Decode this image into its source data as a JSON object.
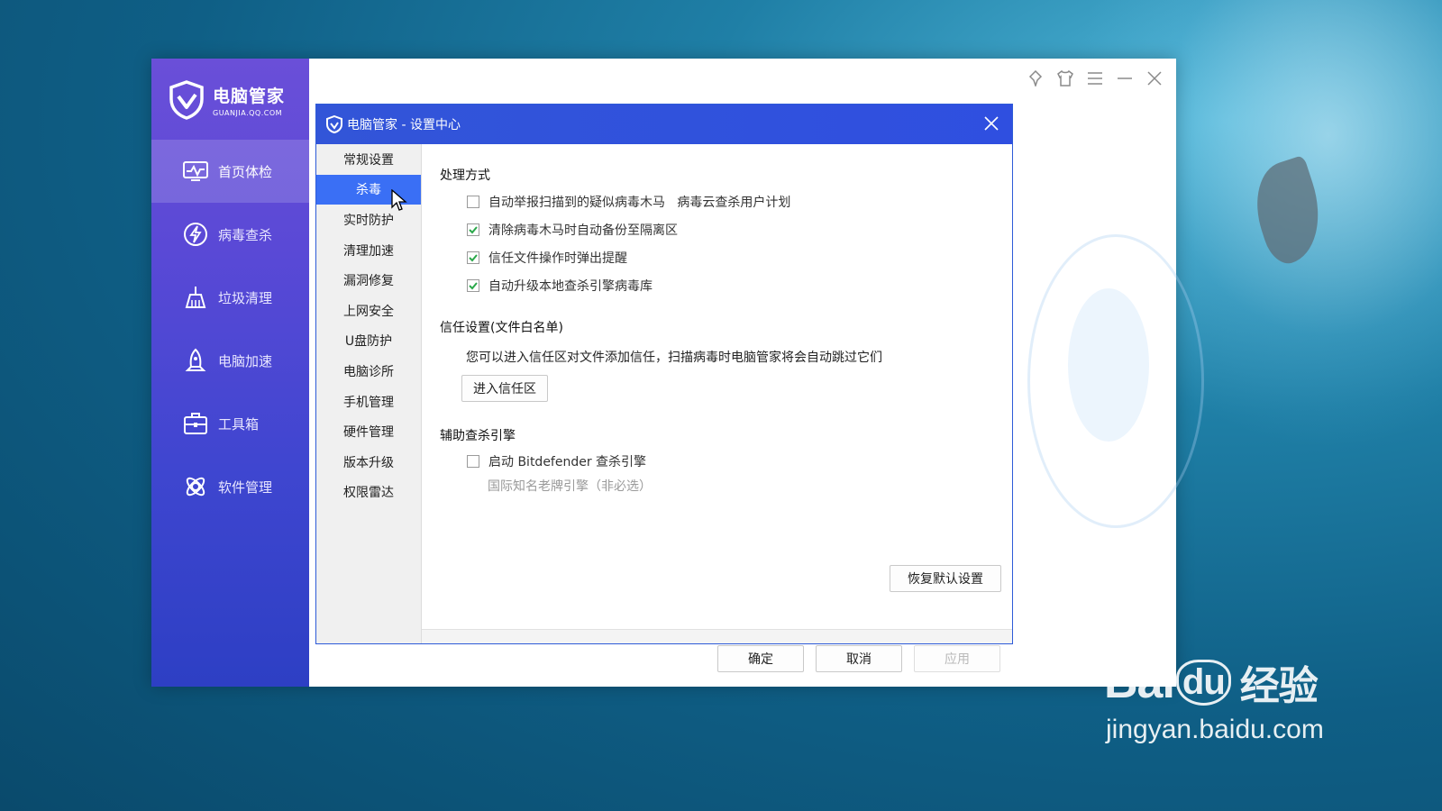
{
  "app": {
    "logo_title": "电脑管家",
    "logo_subtitle": "GUANJIA.QQ.COM",
    "nav": [
      {
        "label": "首页体检",
        "icon": "monitor-pulse-icon",
        "active": true
      },
      {
        "label": "病毒查杀",
        "icon": "lightning-shield-icon"
      },
      {
        "label": "垃圾清理",
        "icon": "broom-icon"
      },
      {
        "label": "电脑加速",
        "icon": "rocket-icon"
      },
      {
        "label": "工具箱",
        "icon": "toolbox-icon"
      },
      {
        "label": "软件管理",
        "icon": "apps-icon"
      }
    ],
    "window_controls": [
      "pin-icon",
      "shirt-skin-icon",
      "menu-icon",
      "minimize-icon",
      "close-icon"
    ]
  },
  "dialog": {
    "title": "电脑管家 - 设置中心",
    "left_nav": [
      "常规设置",
      "杀毒",
      "实时防护",
      "清理加速",
      "漏洞修复",
      "上网安全",
      "U盘防护",
      "电脑诊所",
      "手机管理",
      "硬件管理",
      "版本升级",
      "权限雷达"
    ],
    "active_index": 1,
    "section1_title": "处理方式",
    "options": [
      {
        "label": "自动举报扫描到的疑似病毒木马   病毒云查杀用户计划",
        "checked": false
      },
      {
        "label": "清除病毒木马时自动备份至隔离区",
        "checked": true
      },
      {
        "label": "信任文件操作时弹出提醒",
        "checked": true
      },
      {
        "label": "自动升级本地查杀引擎病毒库",
        "checked": true
      }
    ],
    "section2_title": "信任设置(文件白名单)",
    "trust_desc": "您可以进入信任区对文件添加信任，扫描病毒时电脑管家将会自动跳过它们",
    "trust_button": "进入信任区",
    "section3_title": "辅助查杀引擎",
    "engine_option": {
      "label": "启动 Bitdefender 查杀引擎",
      "checked": false
    },
    "engine_note": "国际知名老牌引擎（非必选）",
    "restore_button": "恢复默认设置",
    "ok_button": "确定",
    "cancel_button": "取消",
    "apply_button": "应用"
  },
  "watermark": {
    "brand": "Bai",
    "brand_paw": "du",
    "brand_cn": "经验",
    "url": "jingyan.baidu.com"
  }
}
